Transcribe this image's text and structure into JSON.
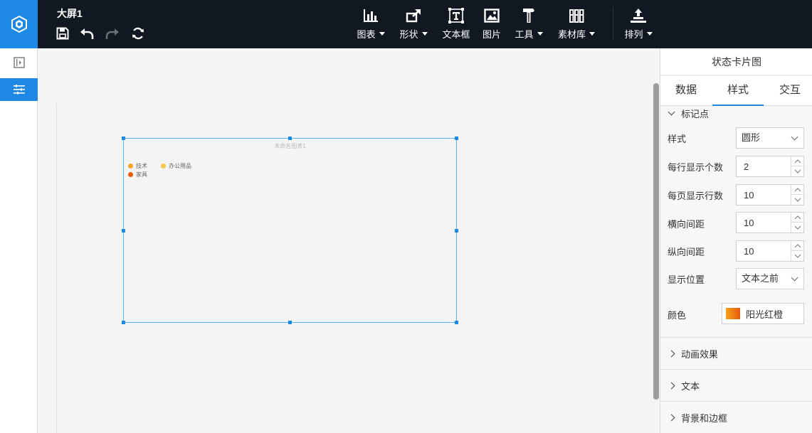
{
  "header": {
    "doc_title": "大屏1",
    "quick_actions": [
      {
        "name": "save",
        "icon": "save-icon"
      },
      {
        "name": "undo",
        "icon": "undo-icon"
      },
      {
        "name": "redo",
        "icon": "redo-icon"
      },
      {
        "name": "refresh",
        "icon": "refresh-icon"
      }
    ],
    "tools": [
      {
        "label": "图表",
        "icon": "bar-chart-icon",
        "has_dropdown": true
      },
      {
        "label": "形状",
        "icon": "shape-icon",
        "has_dropdown": true
      },
      {
        "label": "文本框",
        "icon": "textbox-icon",
        "has_dropdown": false
      },
      {
        "label": "图片",
        "icon": "image-icon",
        "has_dropdown": false
      },
      {
        "label": "工具",
        "icon": "hammer-icon",
        "has_dropdown": true
      },
      {
        "label": "素材库",
        "icon": "library-icon",
        "has_dropdown": true
      },
      {
        "label": "排列",
        "icon": "arrange-icon",
        "has_dropdown": true
      }
    ]
  },
  "sidebar": {
    "items": [
      {
        "icon": "panel-toggle-icon",
        "active": false
      },
      {
        "icon": "list-settings-icon",
        "active": true
      }
    ]
  },
  "canvas": {
    "widget": {
      "title": "未命名图表1",
      "legend": [
        {
          "label": "技术",
          "color": "#f5a623"
        },
        {
          "label": "办公用品",
          "color": "#f7c948"
        },
        {
          "label": "家具",
          "color": "#e8590c"
        }
      ]
    }
  },
  "panel": {
    "title": "状态卡片图",
    "tabs": [
      {
        "label": "数据",
        "active": false
      },
      {
        "label": "样式",
        "active": true
      },
      {
        "label": "交互",
        "active": false
      }
    ],
    "marker_section": {
      "title": "标记点",
      "expanded": true,
      "fields": {
        "style": {
          "label": "样式",
          "value": "圆形"
        },
        "per_row": {
          "label": "每行显示个数",
          "value": "2"
        },
        "rows_per_page": {
          "label": "每页显示行数",
          "value": "10"
        },
        "h_spacing": {
          "label": "横向间距",
          "value": "10"
        },
        "v_spacing": {
          "label": "纵向间距",
          "value": "10"
        },
        "position": {
          "label": "显示位置",
          "value": "文本之前"
        },
        "color": {
          "label": "颜色",
          "value": "阳光红橙",
          "gradient_from": "#f7a21b",
          "gradient_to": "#e8590c"
        }
      }
    },
    "collapsed_sections": [
      {
        "title": "动画效果"
      },
      {
        "title": "文本"
      },
      {
        "title": "背景和边框"
      }
    ]
  },
  "colors": {
    "accent": "#1e88e5",
    "topbar": "#121821",
    "selection": "#4fb3ff"
  }
}
